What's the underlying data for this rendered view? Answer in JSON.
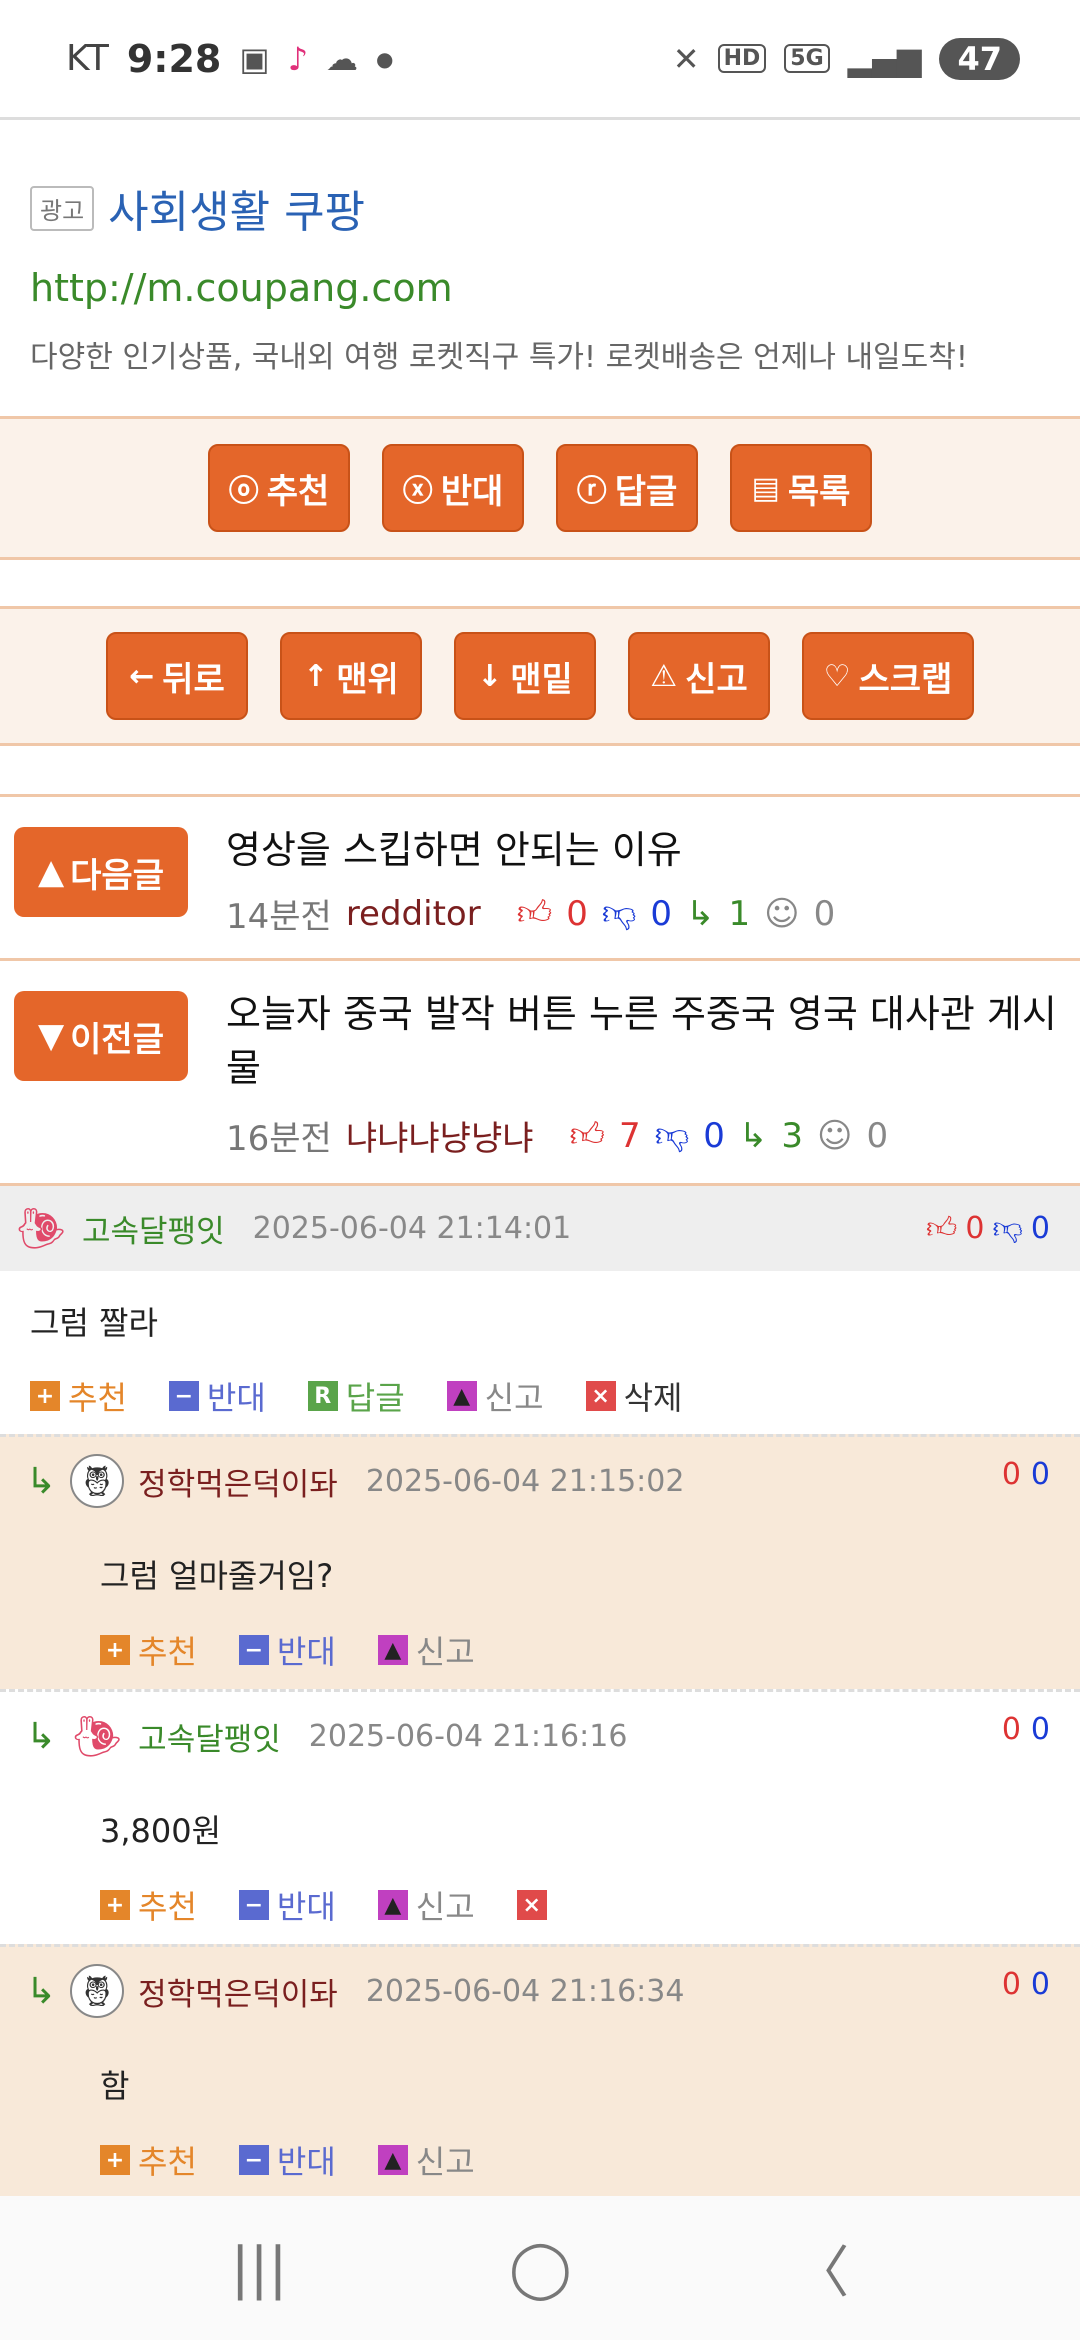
{
  "status_bar": {
    "carrier": "KT",
    "time": "9:28",
    "icons_left": [
      "screenshot-icon",
      "tiktok-icon",
      "cloud-icon",
      "dot-icon"
    ],
    "icons_right": [
      "mute-icon",
      "hd-icon",
      "5g-icon",
      "signal-icon"
    ],
    "hd": "HD",
    "net": "5G",
    "battery": "47"
  },
  "ad": {
    "badge": "광고",
    "title": "사회생활 쿠팡",
    "url": "http://m.coupang.com",
    "description": "다양한 인기상품, 국내외 여행 로켓직구 특가! 로켓배송은 언제나 내일도착!"
  },
  "action_bar": [
    {
      "icon": "ⓞ",
      "label": "추천"
    },
    {
      "icon": "ⓧ",
      "label": "반대"
    },
    {
      "icon": "ⓡ",
      "label": "답글"
    },
    {
      "icon": "▤",
      "label": "목록"
    }
  ],
  "nav_bar_buttons": [
    {
      "icon": "←",
      "label": "뒤로"
    },
    {
      "icon": "↑",
      "label": "맨위"
    },
    {
      "icon": "↓",
      "label": "맨밑"
    },
    {
      "icon": "⚠",
      "label": "신고"
    },
    {
      "icon": "♡",
      "label": "스크랩"
    }
  ],
  "next_post": {
    "button": "다음글",
    "title": "영상을 스킵하면 안되는 이유",
    "time": "14분전",
    "author": "redditor",
    "up": "0",
    "down": "0",
    "replies": "1",
    "emo": "0"
  },
  "prev_post": {
    "button": "이전글",
    "title": "오늘자 중국 발작 버튼 누른 주중국 영국 대사관 게시물",
    "time": "16분전",
    "author": "냐냐냐냥냥냐",
    "up": "7",
    "down": "0",
    "replies": "3",
    "emo": "0"
  },
  "comments": [
    {
      "nick": "고속달팽잇",
      "date": "2025-06-04 21:14:01",
      "up": "0",
      "down": "0",
      "body": "그럼 짤라",
      "actions": {
        "recommend": "추천",
        "oppose": "반대",
        "reply": "답글",
        "report": "신고",
        "delete": "삭제"
      }
    }
  ],
  "replies": [
    {
      "nick": "정학먹은덕이돠",
      "date": "2025-06-04 21:15:02",
      "up": "0",
      "down": "0",
      "body": "그럼 얼마줄거임?",
      "recommend": "추천",
      "oppose": "반대",
      "report": "신고"
    },
    {
      "nick": "고속달팽잇",
      "date": "2025-06-04 21:16:16",
      "up": "0",
      "down": "0",
      "body": "3,800원",
      "recommend": "추천",
      "oppose": "반대",
      "report": "신고"
    },
    {
      "nick": "정학먹은덕이돠",
      "date": "2025-06-04 21:16:34",
      "up": "0",
      "down": "0",
      "body": "함",
      "recommend": "추천",
      "oppose": "반대",
      "report": "신고"
    }
  ],
  "system_nav": {
    "recent": "|||",
    "home": "◯",
    "back": "〈"
  },
  "colors": {
    "accent": "#e4662a",
    "link_blue": "#2a62b4",
    "url_green": "#3a8a2a",
    "beige": "#f8e9d9"
  }
}
